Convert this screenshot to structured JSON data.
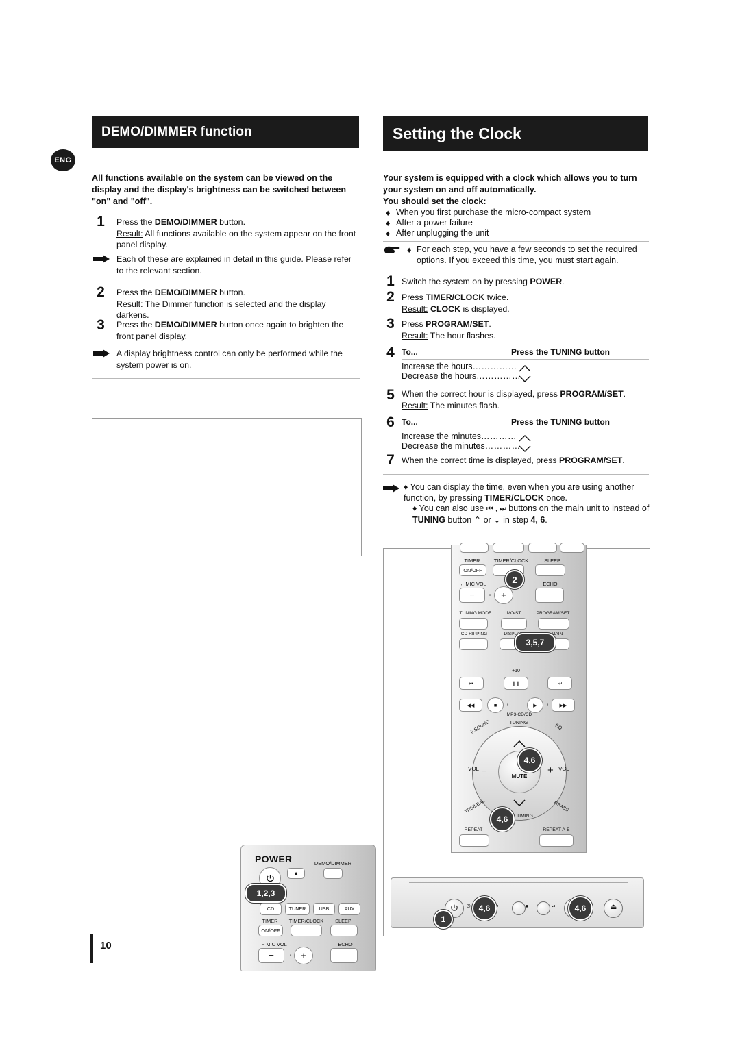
{
  "page": {
    "number": "10",
    "lang_badge": "ENG"
  },
  "left": {
    "title": "DEMO/DIMMER function",
    "intro": "All functions available on the system can be viewed on the display and the display's  brightness can be switched between \"on\" and \"off\".",
    "steps": [
      {
        "no": "1",
        "text": "Press the DEMO/DIMMER button.",
        "bold": "DEMO/DIMMER",
        "result_label": "Result:",
        "result": "All functions available on the system appear on the front panel display."
      },
      {
        "no": "2",
        "text": "Press the DEMO/DIMMER button.",
        "result_label": "Result:",
        "result": "The Dimmer function is selected and the display darkens."
      },
      {
        "no": "3",
        "text": "Press the DEMO/DIMMER button once again to brighten the front panel display.",
        "result_label": "",
        "result": ""
      }
    ],
    "notes": [
      "Each of these are explained in detail in this guide. Please refer to the relevant section.",
      "A display brightness control can only be performed while the system power is on."
    ],
    "remote": {
      "power_label": "POWER",
      "demo_dimmer": "DEMO/DIMMER",
      "callout": "1,2,3",
      "buttons": [
        "CD",
        "TUNER",
        "USB",
        "AUX",
        "TIMER ON/OFF",
        "TIMER/CLOCK",
        "SLEEP",
        "MIC VOL",
        "ECHO"
      ],
      "row2": [
        "CD",
        "TUNER",
        "USB",
        "AUX"
      ],
      "row3_labels": [
        "TIMER",
        "TIMER/CLOCK",
        "SLEEP"
      ],
      "row3_btn": "ON/OFF",
      "mic_label": "MIC VOL",
      "echo_label": "ECHO",
      "minus": "−",
      "plus": "+"
    }
  },
  "right": {
    "title": "Setting the Clock",
    "intro_bold": "Your system is equipped with a clock which allows you to turn your system on and off automatically.",
    "intro_bold2": "You should set the clock:",
    "bullets": [
      "When you first purchase the micro-compact system",
      "After a power failure",
      "After unplugging the unit"
    ],
    "hand_note": "For each step, you have a few seconds to set the required options. If you exceed this time, you must start again.",
    "steps": [
      {
        "no": "1",
        "text": "Switch the system on by pressing POWER.",
        "bold": "POWER"
      },
      {
        "no": "2",
        "text": "Press TIMER/CLOCK twice.",
        "bold": "TIMER/CLOCK",
        "result_label": "Result:",
        "result_bold": "CLOCK",
        "result_tail": "is displayed."
      },
      {
        "no": "3",
        "text": "Press PROGRAM/SET.",
        "bold": "PROGRAM/SET"
      },
      {
        "no": "4",
        "result_label": "Result:",
        "result": "The hour flashes."
      },
      {
        "no": "5",
        "text": "When the correct hour is displayed, press PROGRAM/SET.",
        "bold": "PROGRAM/SET",
        "result_label": "Result:",
        "result": "The minutes flash."
      },
      {
        "no": "7",
        "text": "When the correct time is displayed, press PROGRAM/SET.",
        "bold": "PROGRAM/SET"
      }
    ],
    "table1": {
      "col1": "To...",
      "col2": "Press the TUNING button",
      "rows": [
        {
          "label": "Increase the hours",
          "dots": "……………",
          "icon": "chevron-up"
        },
        {
          "label": "Decrease the hours",
          "dots": "……………",
          "icon": "chevron-down"
        }
      ]
    },
    "table2": {
      "col1": "To...",
      "col2": "Press the TUNING button",
      "rows": [
        {
          "label": "Increase the minutes",
          "dots": "…………",
          "icon": "chevron-up"
        },
        {
          "label": "Decrease the minutes",
          "dots": "…………",
          "icon": "chevron-down"
        }
      ]
    },
    "footnotes": [
      "You can display the time, even when you are using another function, by pressing TIMER/CLOCK once.",
      "You can also use          buttons on the main unit to instead of TUNING button        or        in step 4, 6."
    ],
    "footnote_bolds": [
      "TIMER/CLOCK",
      "TUNING",
      "4, 6"
    ],
    "remote": {
      "callouts": [
        "2",
        "3,5,7",
        "4,6",
        "4,6"
      ],
      "labels_row1": [
        "TIMER",
        "TIMER/CLOCK",
        "SLEEP"
      ],
      "onoff": "ON/OFF",
      "echo": "ECHO",
      "micvol": "MIC VOL",
      "row_mode": [
        "TUNING MODE",
        "MO/ST",
        "PROGRAM/SET"
      ],
      "row_rip": [
        "CD RIPPING",
        "DISPLAY",
        "MAIN"
      ],
      "plus10": "+10",
      "mp3cd": "MP3-CD/CD",
      "psound": "P.SOUND",
      "tuning": "TUNING",
      "eq": "EQ",
      "vol_left": "VOL",
      "vol_right": "VOL",
      "mute": "MUTE",
      "treb_bal": "TREB/BAL",
      "timing": "TIMING",
      "pbass": "P.BASS",
      "repeat": "REPEAT",
      "repeat_ab": "REPEAT A-B"
    },
    "front": {
      "callouts": [
        "4,6",
        "4,6",
        "1"
      ]
    }
  }
}
